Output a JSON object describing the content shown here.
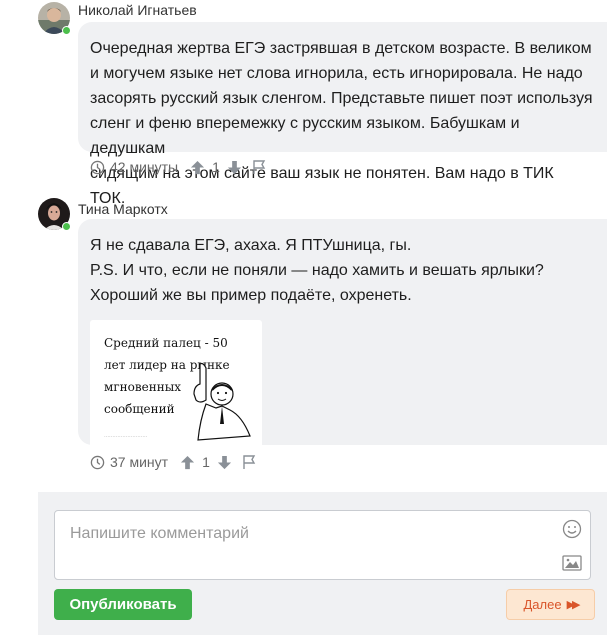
{
  "comments": [
    {
      "author": "Николай Игнатьев",
      "lines": [
        "Очередная жертва ЕГЭ застрявшая в детском возрасте. В великом",
        "и могучем языке нет слова игнорила, есть игнорировала. Не надо",
        "засорять русский язык сленгом. Представьте пишет поэт используя",
        "сленг и феню вперемежку с русским языком. Бабушкам и дедушкам",
        "сидящим на этом сайте ваш язык не понятен. Вам надо в ТИК ТОК."
      ],
      "time": "42 минуты",
      "votes": "1",
      "icons": [
        "clock-icon",
        "upvote-icon",
        "downvote-icon",
        "flag-icon"
      ]
    },
    {
      "author": "Тина Маркотх",
      "lines": [
        "Я не сдавала ЕГЭ, ахаха. Я ПТУшница, гы.",
        "P.S. И что, если не поняли — надо хамить и вешать ярлыки?",
        "Хороший же вы пример подаёте, охренеть."
      ],
      "image_text": "Средний палец - 50\nлет лидер на рынке\nмгновенных\nсообщений",
      "time": "37 минут",
      "votes": "1",
      "icons": [
        "clock-icon",
        "upvote-icon",
        "downvote-icon",
        "flag-icon"
      ]
    }
  ],
  "composer": {
    "placeholder": "Напишите комментарий",
    "publish_label": "Опубликовать",
    "next_label": "Далее",
    "icons": [
      "emoji-icon",
      "image-icon"
    ]
  },
  "colors": {
    "bubble": "#f0f1f3",
    "publish": "#3faf4b",
    "next_bg": "#fde7d2",
    "next_text": "#d9552a",
    "online": "#4cbf4c"
  }
}
